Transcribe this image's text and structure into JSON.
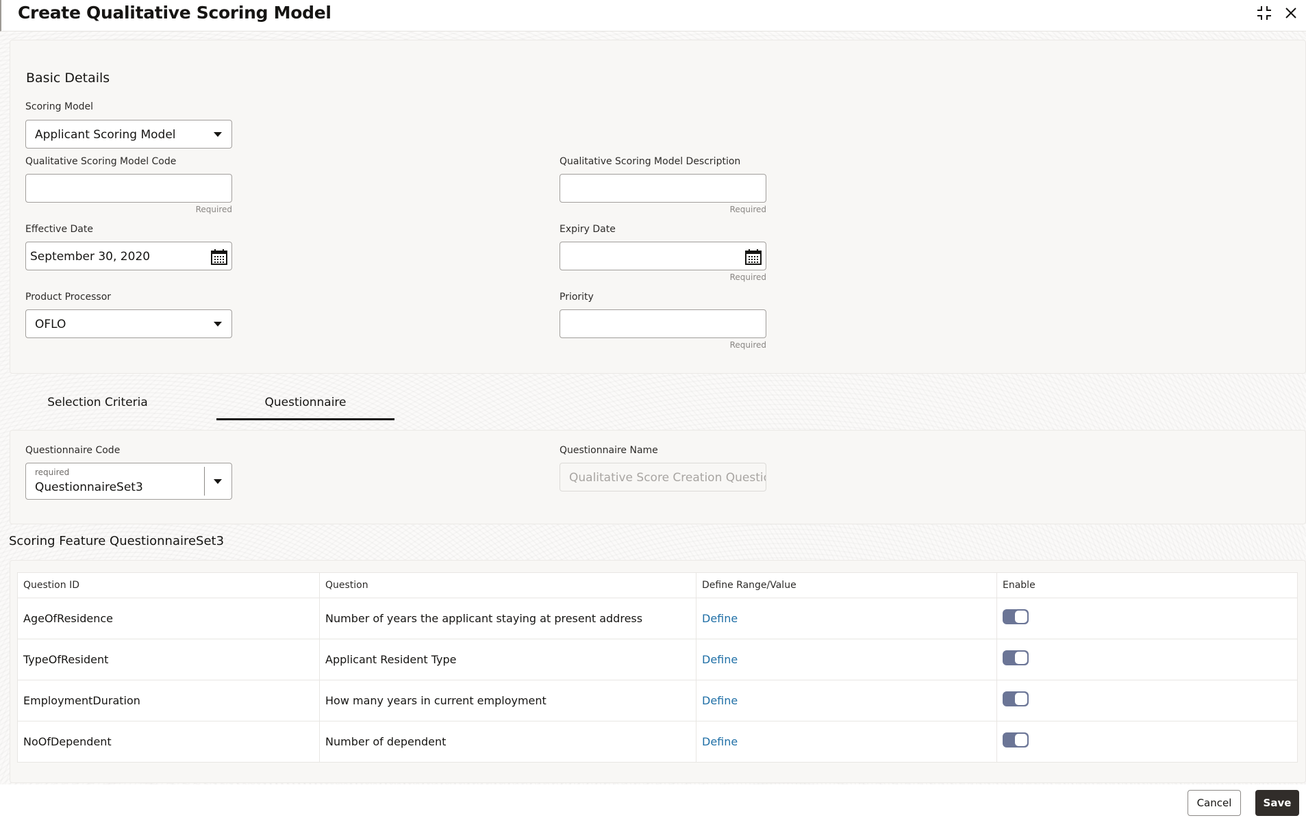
{
  "header": {
    "title": "Create Qualitative Scoring Model",
    "icons": [
      "minimize-icon",
      "close-icon"
    ]
  },
  "basic_details": {
    "section_title": "Basic Details",
    "scoring_model": {
      "label": "Scoring Model",
      "value": "Applicant Scoring Model"
    },
    "model_code": {
      "label": "Qualitative Scoring Model Code",
      "value": "",
      "hint": "Required"
    },
    "model_description": {
      "label": "Qualitative Scoring Model Description",
      "value": "",
      "hint": "Required"
    },
    "effective_date": {
      "label": "Effective Date",
      "value": "September 30, 2020"
    },
    "expiry_date": {
      "label": "Expiry Date",
      "value": "",
      "hint": "Required"
    },
    "product_processor": {
      "label": "Product Processor",
      "value": "OFLO"
    },
    "priority": {
      "label": "Priority",
      "value": "",
      "hint": "Required"
    }
  },
  "tabs": [
    {
      "label": "Selection Criteria",
      "active": false
    },
    {
      "label": "Questionnaire",
      "active": true
    }
  ],
  "questionnaire": {
    "code": {
      "label": "Questionnaire Code",
      "floating_label": "required",
      "value": "QuestionnaireSet3"
    },
    "name": {
      "label": "Questionnaire Name",
      "value": "Qualitative Score Creation Questionr"
    }
  },
  "scoring_feature": {
    "title": "Scoring Feature QuestionnaireSet3",
    "columns": [
      "Question ID",
      "Question",
      "Define Range/Value",
      "Enable"
    ],
    "rows": [
      {
        "id": "AgeOfResidence",
        "question": "Number of years the applicant staying at present address",
        "define": "Define",
        "enabled": true
      },
      {
        "id": "TypeOfResident",
        "question": "Applicant Resident Type",
        "define": "Define",
        "enabled": true
      },
      {
        "id": "EmploymentDuration",
        "question": "How many years in current employment",
        "define": "Define",
        "enabled": true
      },
      {
        "id": "NoOfDependent",
        "question": "Number of dependent",
        "define": "Define",
        "enabled": true
      }
    ]
  },
  "footer": {
    "cancel_label": "Cancel",
    "save_label": "Save"
  },
  "colors": {
    "toggle_on": "#6b7596",
    "link": "#1f6fa6",
    "primary_button": "#312d2a"
  }
}
